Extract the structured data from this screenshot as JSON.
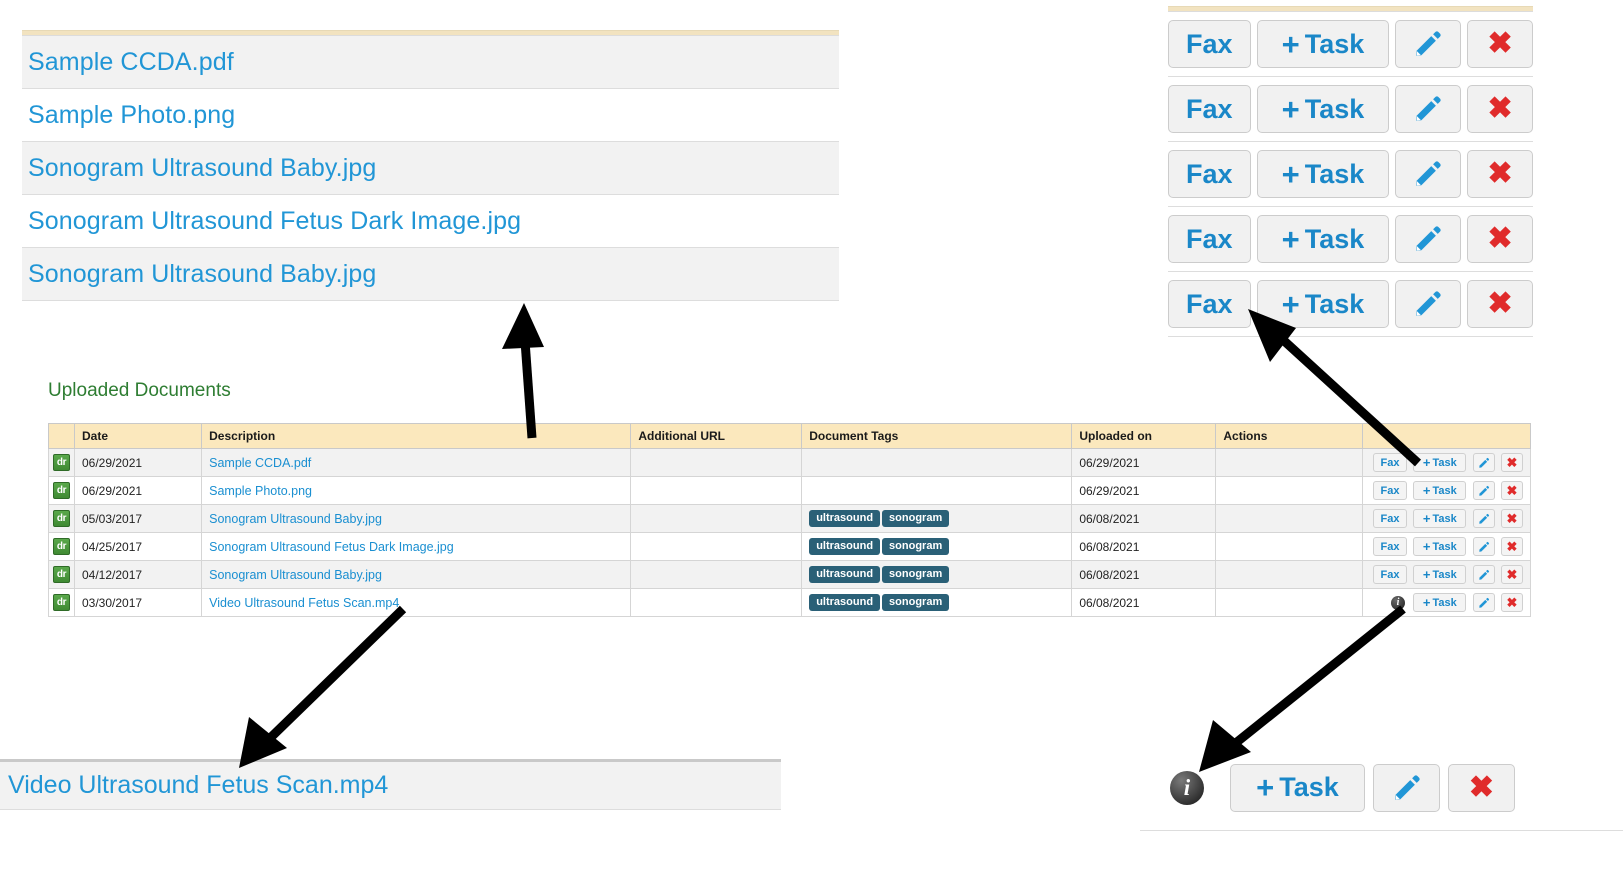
{
  "file_list": {
    "items": [
      {
        "name": "Sample CCDA.pdf"
      },
      {
        "name": "Sample Photo.png"
      },
      {
        "name": "Sonogram Ultrasound Baby.jpg"
      },
      {
        "name": "Sonogram Ultrasound Fetus Dark Image.jpg"
      },
      {
        "name": "Sonogram Ultrasound Baby.jpg"
      }
    ]
  },
  "action_panel": {
    "rows": [
      {
        "fax": "Fax",
        "task": "+ Task",
        "plus": "+",
        "task_text": "Task",
        "delete": "✖"
      },
      {
        "fax": "Fax",
        "task": "+ Task",
        "plus": "+",
        "task_text": "Task",
        "delete": "✖"
      },
      {
        "fax": "Fax",
        "task": "+ Task",
        "plus": "+",
        "task_text": "Task",
        "delete": "✖"
      },
      {
        "fax": "Fax",
        "task": "+ Task",
        "plus": "+",
        "task_text": "Task",
        "delete": "✖"
      },
      {
        "fax": "Fax",
        "task": "+ Task",
        "plus": "+",
        "task_text": "Task",
        "delete": "✖"
      }
    ]
  },
  "section": {
    "title": "Uploaded Documents"
  },
  "table": {
    "headers": [
      "",
      "Date",
      "Description",
      "Additional URL",
      "Document Tags",
      "Uploaded on",
      "Actions",
      ""
    ],
    "rows": [
      {
        "icon_label": "dr",
        "date": "06/29/2021",
        "description": "Sample CCDA.pdf",
        "additional_url": "",
        "tags": [],
        "uploaded_on": "06/29/2021",
        "actions": "",
        "has_fax": true,
        "has_info": false,
        "fax_label": "Fax",
        "plus": "+",
        "task_label": "Task",
        "delete_label": "✖"
      },
      {
        "icon_label": "dr",
        "date": "06/29/2021",
        "description": "Sample Photo.png",
        "additional_url": "",
        "tags": [],
        "uploaded_on": "06/29/2021",
        "actions": "",
        "has_fax": true,
        "has_info": false,
        "fax_label": "Fax",
        "plus": "+",
        "task_label": "Task",
        "delete_label": "✖"
      },
      {
        "icon_label": "dr",
        "date": "05/03/2017",
        "description": "Sonogram Ultrasound Baby.jpg",
        "additional_url": "",
        "tags": [
          "ultrasound",
          "sonogram"
        ],
        "uploaded_on": "06/08/2021",
        "actions": "",
        "has_fax": true,
        "has_info": false,
        "fax_label": "Fax",
        "plus": "+",
        "task_label": "Task",
        "delete_label": "✖"
      },
      {
        "icon_label": "dr",
        "date": "04/25/2017",
        "description": "Sonogram Ultrasound Fetus Dark Image.jpg",
        "additional_url": "",
        "tags": [
          "ultrasound",
          "sonogram"
        ],
        "uploaded_on": "06/08/2021",
        "actions": "",
        "has_fax": true,
        "has_info": false,
        "fax_label": "Fax",
        "plus": "+",
        "task_label": "Task",
        "delete_label": "✖"
      },
      {
        "icon_label": "dr",
        "date": "04/12/2017",
        "description": "Sonogram Ultrasound Baby.jpg",
        "additional_url": "",
        "tags": [
          "ultrasound",
          "sonogram"
        ],
        "uploaded_on": "06/08/2021",
        "actions": "",
        "has_fax": true,
        "has_info": false,
        "fax_label": "Fax",
        "plus": "+",
        "task_label": "Task",
        "delete_label": "✖"
      },
      {
        "icon_label": "dr",
        "date": "03/30/2017",
        "description": "Video Ultrasound Fetus Scan.mp4",
        "additional_url": "",
        "tags": [
          "ultrasound",
          "sonogram"
        ],
        "uploaded_on": "06/08/2021",
        "actions": "",
        "has_fax": false,
        "has_info": true,
        "info_label": "i",
        "plus": "+",
        "task_label": "Task",
        "delete_label": "✖"
      }
    ]
  },
  "video_row": {
    "name": "Video Ultrasound Fetus Scan.mp4"
  },
  "last_action_row": {
    "info_label": "i",
    "plus": "+",
    "task_label": "Task",
    "delete_label": "✖"
  },
  "colors": {
    "link": "#1a8fd1",
    "header_cream": "#fbe8bd",
    "tag_bg": "#2a6077",
    "section_green": "#2e7d32",
    "delete_red": "#e02b2b",
    "button_blue": "#1a87c8",
    "badge_green": "#3f8a33"
  }
}
